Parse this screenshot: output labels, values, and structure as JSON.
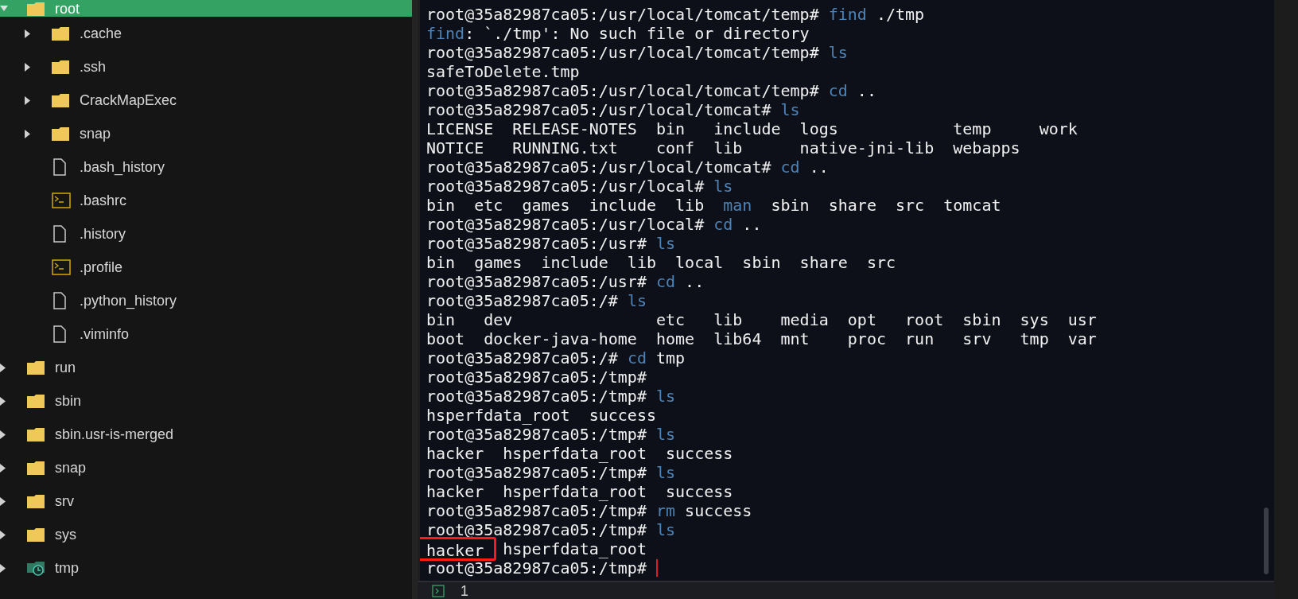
{
  "sidebar": {
    "items": [
      {
        "name": "root",
        "kind": "folder",
        "expanded": true,
        "selected": true,
        "children": [
          {
            "name": ".cache",
            "kind": "folder",
            "expanded": false,
            "selected": false
          },
          {
            "name": ".ssh",
            "kind": "folder",
            "expanded": false,
            "selected": false
          },
          {
            "name": "CrackMapExec",
            "kind": "folder",
            "expanded": false,
            "selected": false
          },
          {
            "name": "snap",
            "kind": "folder",
            "expanded": false,
            "selected": false
          },
          {
            "name": ".bash_history",
            "kind": "file",
            "selected": false
          },
          {
            "name": ".bashrc",
            "kind": "script",
            "selected": false
          },
          {
            "name": ".history",
            "kind": "file",
            "selected": false
          },
          {
            "name": ".profile",
            "kind": "script",
            "selected": false
          },
          {
            "name": ".python_history",
            "kind": "file",
            "selected": false
          },
          {
            "name": ".viminfo",
            "kind": "file",
            "selected": false
          }
        ]
      },
      {
        "name": "run",
        "kind": "folder",
        "expanded": false,
        "selected": false
      },
      {
        "name": "sbin",
        "kind": "folder",
        "expanded": false,
        "selected": false
      },
      {
        "name": "sbin.usr-is-merged",
        "kind": "folder",
        "expanded": false,
        "selected": false
      },
      {
        "name": "snap",
        "kind": "folder",
        "expanded": false,
        "selected": false
      },
      {
        "name": "srv",
        "kind": "folder",
        "expanded": false,
        "selected": false
      },
      {
        "name": "sys",
        "kind": "folder",
        "expanded": false,
        "selected": false
      },
      {
        "name": "tmp",
        "kind": "temp-folder",
        "expanded": false,
        "selected": false
      }
    ]
  },
  "terminal": {
    "lines": [
      [
        {
          "kind": "text",
          "text": "root@35a82987ca05:/usr/local/tomcat/temp# "
        },
        {
          "kind": "command",
          "text": "find"
        },
        {
          "kind": "text",
          "text": " ./tmp"
        }
      ],
      [
        {
          "kind": "command",
          "text": "find"
        },
        {
          "kind": "text",
          "text": ": `./tmp': No such file or directory"
        }
      ],
      [
        {
          "kind": "text",
          "text": "root@35a82987ca05:/usr/local/tomcat/temp# "
        },
        {
          "kind": "command",
          "text": "ls"
        }
      ],
      [
        {
          "kind": "text",
          "text": "safeToDelete.tmp"
        }
      ],
      [
        {
          "kind": "text",
          "text": "root@35a82987ca05:/usr/local/tomcat/temp# "
        },
        {
          "kind": "command",
          "text": "cd"
        },
        {
          "kind": "text",
          "text": " .."
        }
      ],
      [
        {
          "kind": "text",
          "text": "root@35a82987ca05:/usr/local/tomcat# "
        },
        {
          "kind": "command",
          "text": "ls"
        }
      ],
      [
        {
          "kind": "text",
          "text": "LICENSE  RELEASE-NOTES  bin   include  logs            temp     work"
        }
      ],
      [
        {
          "kind": "text",
          "text": "NOTICE   RUNNING.txt    conf  lib      native-jni-lib  webapps"
        }
      ],
      [
        {
          "kind": "text",
          "text": "root@35a82987ca05:/usr/local/tomcat# "
        },
        {
          "kind": "command",
          "text": "cd"
        },
        {
          "kind": "text",
          "text": " .."
        }
      ],
      [
        {
          "kind": "text",
          "text": "root@35a82987ca05:/usr/local# "
        },
        {
          "kind": "command",
          "text": "ls"
        }
      ],
      [
        {
          "kind": "text",
          "text": "bin  etc  games  include  lib  "
        },
        {
          "kind": "command",
          "text": "man"
        },
        {
          "kind": "text",
          "text": "  sbin  share  src  tomcat"
        }
      ],
      [
        {
          "kind": "text",
          "text": "root@35a82987ca05:/usr/local# "
        },
        {
          "kind": "command",
          "text": "cd"
        },
        {
          "kind": "text",
          "text": " .."
        }
      ],
      [
        {
          "kind": "text",
          "text": "root@35a82987ca05:/usr# "
        },
        {
          "kind": "command",
          "text": "ls"
        }
      ],
      [
        {
          "kind": "text",
          "text": "bin  games  include  lib  local  sbin  share  src"
        }
      ],
      [
        {
          "kind": "text",
          "text": "root@35a82987ca05:/usr# "
        },
        {
          "kind": "command",
          "text": "cd"
        },
        {
          "kind": "text",
          "text": " .."
        }
      ],
      [
        {
          "kind": "text",
          "text": "root@35a82987ca05:/# "
        },
        {
          "kind": "command",
          "text": "ls"
        }
      ],
      [
        {
          "kind": "text",
          "text": "bin   dev               etc   lib    media  opt   root  sbin  sys  usr"
        }
      ],
      [
        {
          "kind": "text",
          "text": "boot  docker-java-home  home  lib64  mnt    proc  run   srv   tmp  var"
        }
      ],
      [
        {
          "kind": "text",
          "text": "root@35a82987ca05:/# "
        },
        {
          "kind": "command",
          "text": "cd"
        },
        {
          "kind": "text",
          "text": " tmp"
        }
      ],
      [
        {
          "kind": "text",
          "text": "root@35a82987ca05:/tmp#"
        }
      ],
      [
        {
          "kind": "text",
          "text": "root@35a82987ca05:/tmp# "
        },
        {
          "kind": "command",
          "text": "ls"
        }
      ],
      [
        {
          "kind": "text",
          "text": "hsperfdata_root  success"
        }
      ],
      [
        {
          "kind": "text",
          "text": "root@35a82987ca05:/tmp# "
        },
        {
          "kind": "command",
          "text": "ls"
        }
      ],
      [
        {
          "kind": "text",
          "text": "hacker  hsperfdata_root  success"
        }
      ],
      [
        {
          "kind": "text",
          "text": "root@35a82987ca05:/tmp# "
        },
        {
          "kind": "command",
          "text": "ls"
        }
      ],
      [
        {
          "kind": "text",
          "text": "hacker  hsperfdata_root  success"
        }
      ],
      [
        {
          "kind": "text",
          "text": "root@35a82987ca05:/tmp# "
        },
        {
          "kind": "command",
          "text": "rm"
        },
        {
          "kind": "text",
          "text": " success"
        }
      ],
      [
        {
          "kind": "text",
          "text": "root@35a82987ca05:/tmp# "
        },
        {
          "kind": "command",
          "text": "ls"
        }
      ],
      [
        {
          "kind": "highlighted",
          "text": "hacker"
        },
        {
          "kind": "text",
          "text": "  hsperfdata_root"
        }
      ],
      [
        {
          "kind": "text",
          "text": "root@35a82987ca05:/tmp# "
        },
        {
          "kind": "cursor"
        }
      ]
    ]
  },
  "bottom_bar": {
    "tab": "1"
  }
}
